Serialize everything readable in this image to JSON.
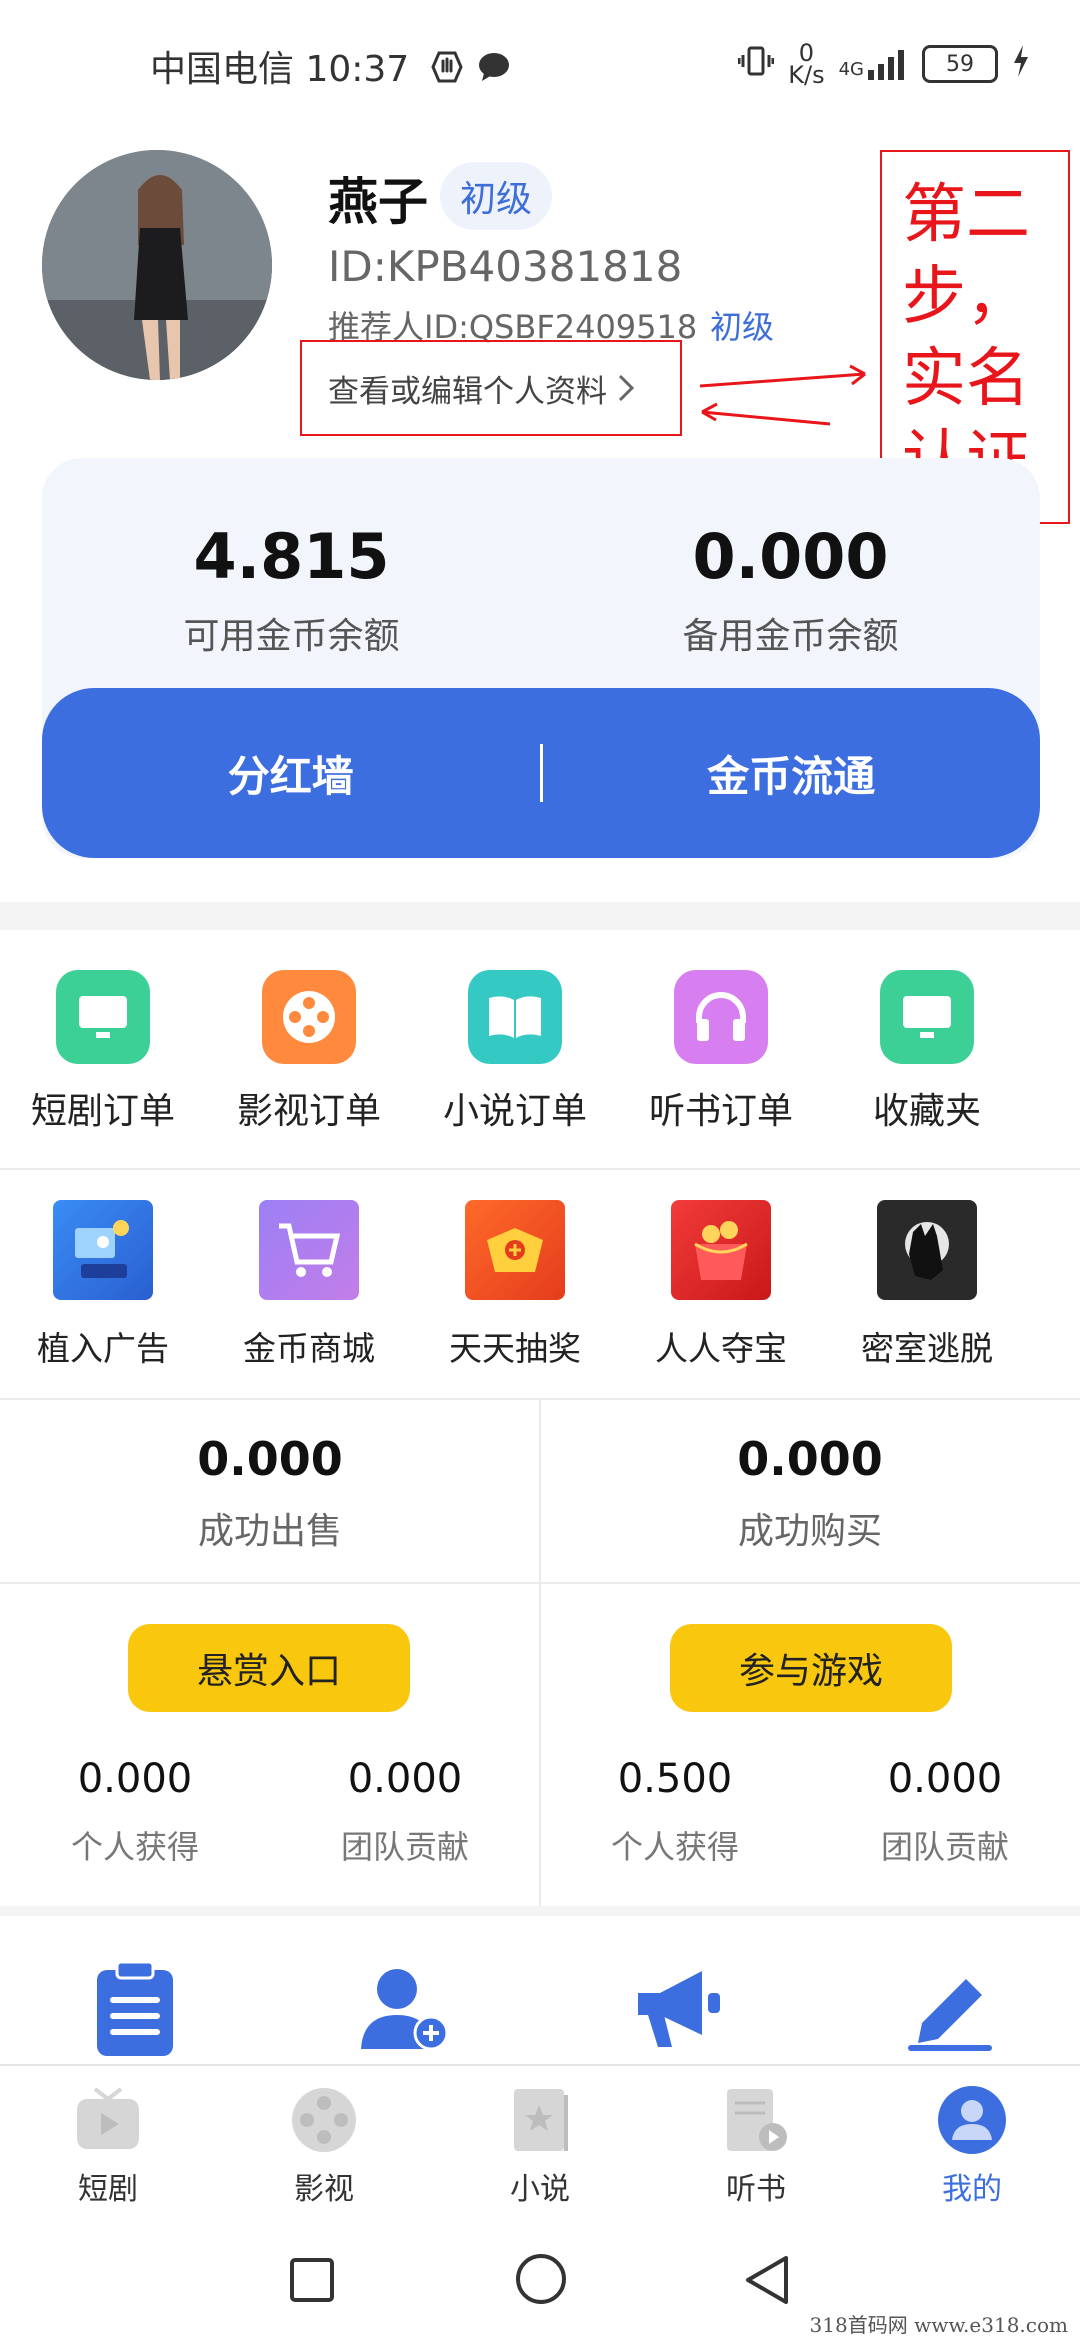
{
  "status_bar": {
    "carrier": "中国电信",
    "time": "10:37",
    "net_speed_top": "0",
    "net_speed_unit": "K/s",
    "network": "4G",
    "battery": "59"
  },
  "profile": {
    "name": "燕子",
    "level": "初级",
    "id": "ID:KPB40381818",
    "referrer": "推荐人ID:QSBF2409518",
    "referrer_level": "初级",
    "edit_link": "查看或编辑个人资料"
  },
  "annotation": {
    "text": "第二步，实名认证",
    "color": "#e8161b"
  },
  "balance": {
    "available_value": "4.815",
    "available_label": "可用金币余额",
    "reserve_value": "0.000",
    "reserve_label": "备用金币余额",
    "left_button": "分红墙",
    "right_button": "金币流通"
  },
  "orders": [
    {
      "label": "短剧订单",
      "icon": "tv-icon",
      "color": "#3ccf96"
    },
    {
      "label": "影视订单",
      "icon": "film-reel-icon",
      "color": "#ff8a3d"
    },
    {
      "label": "小说订单",
      "icon": "book-icon",
      "color": "#35c9c3"
    },
    {
      "label": "听书订单",
      "icon": "headphones-icon",
      "color": "#d77ff0"
    },
    {
      "label": "收藏夹",
      "icon": "tv-icon",
      "color": "#3ccf96"
    }
  ],
  "features": [
    {
      "label": "植入广告",
      "icon": "ad-illustration-icon"
    },
    {
      "label": "金币商城",
      "icon": "shopping-cart-icon"
    },
    {
      "label": "天天抽奖",
      "icon": "lottery-icon"
    },
    {
      "label": "人人夺宝",
      "icon": "red-envelope-icon"
    },
    {
      "label": "密室逃脱",
      "icon": "werewolf-icon"
    }
  ],
  "stats": {
    "sold_value": "0.000",
    "sold_label": "成功出售",
    "bought_value": "0.000",
    "bought_label": "成功购买"
  },
  "rewards": {
    "left_button": "悬赏入口",
    "right_button": "参与游戏",
    "left": [
      {
        "value": "0.000",
        "label": "个人获得"
      },
      {
        "value": "0.000",
        "label": "团队贡献"
      }
    ],
    "right": [
      {
        "value": "0.500",
        "label": "个人获得"
      },
      {
        "value": "0.000",
        "label": "团队贡献"
      }
    ]
  },
  "shortcuts": [
    "clipboard-icon",
    "add-user-icon",
    "megaphone-icon",
    "pencil-icon"
  ],
  "bottom_nav": [
    {
      "label": "短剧",
      "icon": "tv-play-icon",
      "active": false
    },
    {
      "label": "影视",
      "icon": "film-reel-icon",
      "active": false
    },
    {
      "label": "小说",
      "icon": "book-icon",
      "active": false
    },
    {
      "label": "听书",
      "icon": "audiobook-icon",
      "active": false
    },
    {
      "label": "我的",
      "icon": "user-icon",
      "active": true
    }
  ],
  "colors": {
    "accent_blue": "#3d6ee0",
    "yellow": "#f9c80e",
    "annotation_red": "#e8161b"
  },
  "watermark": "318首码网 www.e318.com"
}
